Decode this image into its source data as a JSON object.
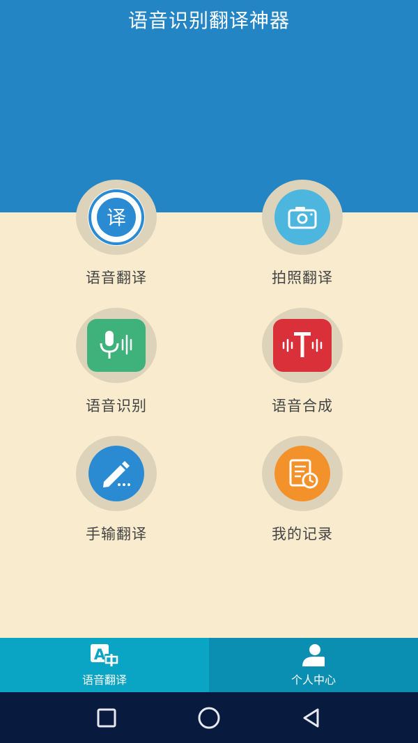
{
  "app": {
    "title": "语音识别翻译神器"
  },
  "features": [
    {
      "label": "语音翻译",
      "icon": "translate-icon",
      "badge_char": "译",
      "color": "#2a8bd2"
    },
    {
      "label": "拍照翻译",
      "icon": "camera-icon",
      "color": "#4cb6de"
    },
    {
      "label": "语音识别",
      "icon": "microphone-icon",
      "color": "#3fb17a"
    },
    {
      "label": "语音合成",
      "icon": "text-to-speech-icon",
      "color": "#d9303a"
    },
    {
      "label": "手输翻译",
      "icon": "pencil-icon",
      "color": "#2a8bd2"
    },
    {
      "label": "我的记录",
      "icon": "history-icon",
      "color": "#f3922a"
    }
  ],
  "bottom_nav": {
    "tabs": [
      {
        "label": "语音翻译",
        "icon": "translate-tab-icon",
        "active": true
      },
      {
        "label": "个人中心",
        "icon": "person-icon",
        "active": false
      }
    ]
  },
  "colors": {
    "header_blue": "#2485c5",
    "background_cream": "#f9ecce",
    "nav_active": "#0aa5c4",
    "nav_inactive": "#0a8fb3",
    "system_bar": "#081a3d"
  }
}
